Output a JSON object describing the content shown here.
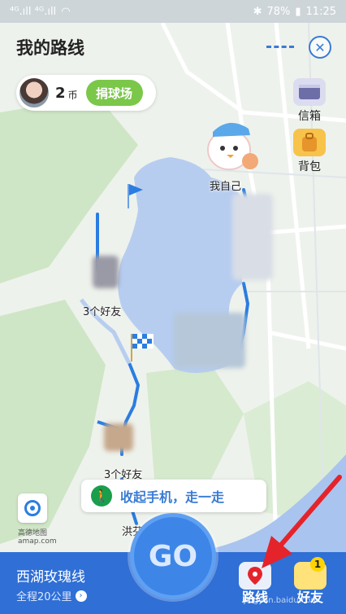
{
  "status": {
    "signal_left": "⁴ᴳ.ıll ⁴ᴳ.ıll",
    "wifi_icon": "wifi-icon",
    "battery": "78%",
    "time": "11:25"
  },
  "header": {
    "title": "我的路线"
  },
  "user": {
    "coin_count": "2",
    "coin_unit": "币",
    "donate_label": "捐球场"
  },
  "side": {
    "mailbox_label": "信箱",
    "backpack_label": "背包"
  },
  "map": {
    "me_label": "我自己",
    "friends_1": "3个好友",
    "friends_2": "3个好友",
    "place_hongfen": "洪芬"
  },
  "tip": {
    "text": "收起手机，走一走"
  },
  "logo": {
    "line1": "高德地图",
    "line2": "amap.com"
  },
  "route": {
    "name": "西湖玫瑰线",
    "distance": "全程20公里"
  },
  "go": {
    "label": "GO"
  },
  "nav": {
    "route_label": "路线",
    "friends_label": "好友",
    "friends_badge": "1"
  },
  "watermark": "jingyan.baidu.com",
  "colors": {
    "accent_blue": "#2f6fd6",
    "lake": "#b7cdf0",
    "green": "#7bc74a",
    "arrow_red": "#e5232b"
  }
}
